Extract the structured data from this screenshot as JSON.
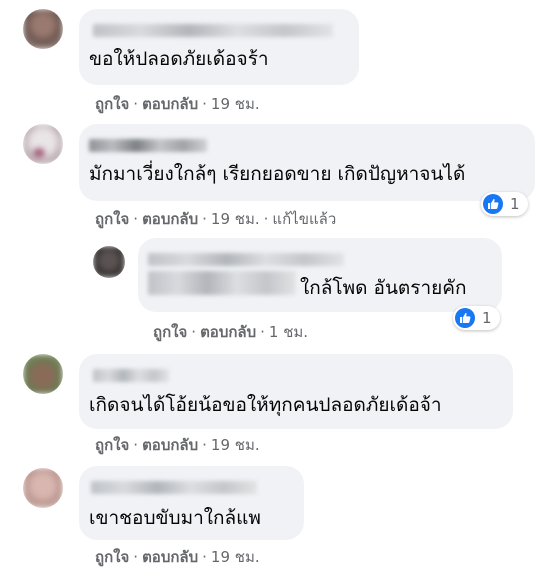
{
  "comments": [
    {
      "text": "ขอให้ปลอดภัยเด้อจร้า",
      "actions": {
        "like": "ถูกใจ",
        "reply": "ตอบกลับ",
        "sep": "·",
        "time": "19 ชม."
      }
    },
    {
      "text": "มักมาเวี่ยงใกล้ๆ เรียกยอดขาย เกิดปัญหาจนได้",
      "actions": {
        "like": "ถูกใจ",
        "reply": "ตอบกลับ",
        "sep": "·",
        "time": "19 ชม.",
        "edited": "แก้ไขแล้ว"
      },
      "reactions": {
        "icon": "like-icon",
        "count": "1"
      },
      "reply": {
        "text": "ใกล้โพด อันตรายคัก",
        "actions": {
          "like": "ถูกใจ",
          "reply": "ตอบกลับ",
          "sep": "·",
          "time": "1 ชม."
        },
        "reactions": {
          "icon": "like-icon",
          "count": "1"
        }
      }
    },
    {
      "text": "เกิดจนได้โอ้ยน้อขอให้ทุกคนปลอดภัยเด้อจ้า",
      "actions": {
        "like": "ถูกใจ",
        "reply": "ตอบกลับ",
        "sep": "·",
        "time": "19 ชม."
      }
    },
    {
      "text": "เขาชอบขับมาใกล้แพ",
      "actions": {
        "like": "ถูกใจ",
        "reply": "ตอบกลับ",
        "sep": "·",
        "time": "19 ชม."
      }
    }
  ],
  "colors": {
    "bubble": "#f0f2f5",
    "secondary_text": "#65676b",
    "like_blue": "#1877f2"
  }
}
